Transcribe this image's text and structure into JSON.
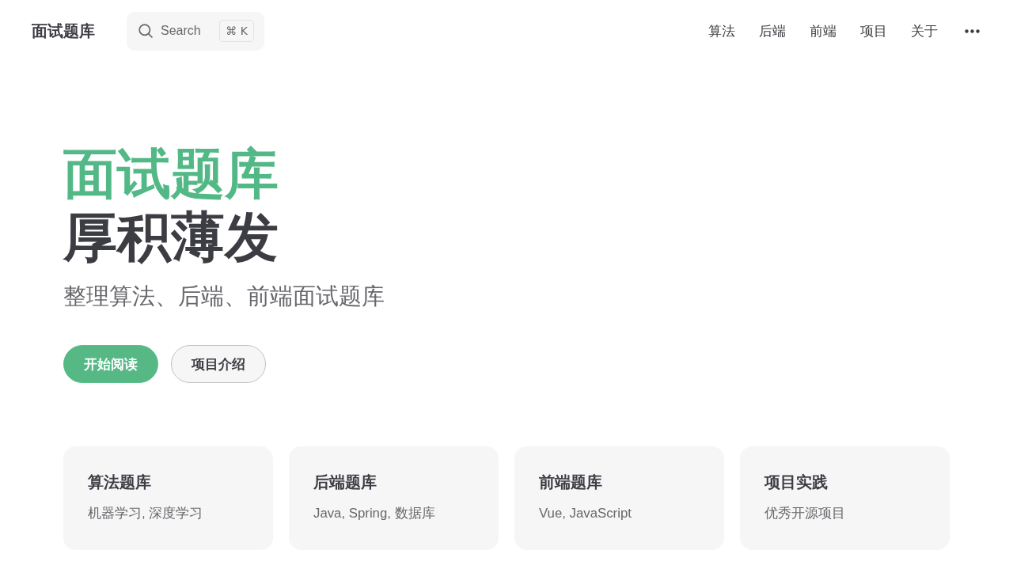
{
  "nav": {
    "title": "面试题库",
    "search": {
      "label": "Search",
      "shortcut": "⌘ K"
    },
    "links": [
      "算法",
      "后端",
      "前端",
      "项目",
      "关于"
    ]
  },
  "hero": {
    "name": "面试题库",
    "text": "厚积薄发",
    "tagline": "整理算法、后端、前端面试题库",
    "actions": [
      {
        "label": "开始阅读",
        "kind": "brand"
      },
      {
        "label": "项目介绍",
        "kind": "alt"
      }
    ]
  },
  "features": [
    {
      "title": "算法题库",
      "details": "机器学习, 深度学习"
    },
    {
      "title": "后端题库",
      "details": "Java, Spring, 数据库"
    },
    {
      "title": "前端题库",
      "details": "Vue, JavaScript"
    },
    {
      "title": "项目实践",
      "details": "优秀开源项目"
    }
  ]
}
